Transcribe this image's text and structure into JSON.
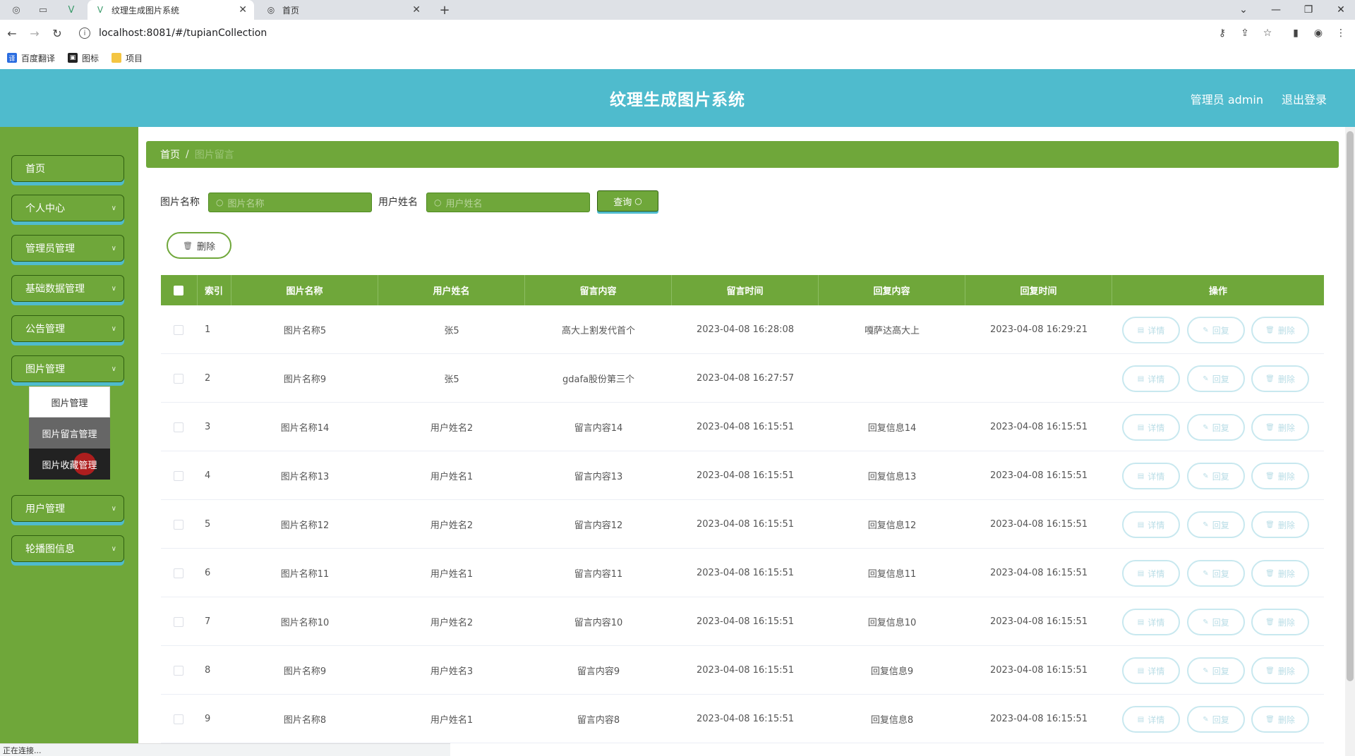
{
  "browser": {
    "tabs": [
      {
        "title": "纹理生成图片系统",
        "active": true
      },
      {
        "title": "首页",
        "active": false
      }
    ],
    "url": "localhost:8081/#/tupianCollection",
    "bookmarks": [
      "百度翻译",
      "图标",
      "项目"
    ],
    "status": "正在连接..."
  },
  "header": {
    "title": "纹理生成图片系统",
    "admin": "管理员 admin",
    "logout": "退出登录",
    "color": "#4fbbcd"
  },
  "sidebar": {
    "color": "#6fa73a",
    "items": [
      {
        "label": "首页",
        "expandable": false
      },
      {
        "label": "个人中心",
        "expandable": true
      },
      {
        "label": "管理员管理",
        "expandable": true
      },
      {
        "label": "基础数据管理",
        "expandable": true
      },
      {
        "label": "公告管理",
        "expandable": true
      },
      {
        "label": "图片管理",
        "expandable": true
      },
      {
        "label": "用户管理",
        "expandable": true
      },
      {
        "label": "轮播图信息",
        "expandable": true
      }
    ],
    "submenu": [
      "图片管理",
      "图片留言管理",
      "图片收藏管理"
    ]
  },
  "breadcrumb": {
    "home": "首页",
    "separator": "/",
    "current": "图片留言"
  },
  "filters": {
    "name_label": "图片名称",
    "name_placeholder": "图片名称",
    "user_label": "用户姓名",
    "user_placeholder": "用户姓名",
    "search_label": "查询"
  },
  "toolbar": {
    "delete_label": "删除"
  },
  "table": {
    "headers": [
      "索引",
      "图片名称",
      "用户姓名",
      "留言内容",
      "留言时间",
      "回复内容",
      "回复时间",
      "操作"
    ],
    "actions": [
      "详情",
      "回复",
      "删除"
    ],
    "rows": [
      [
        "1",
        "图片名称5",
        "张5",
        "高大上割发代首个",
        "2023-04-08 16:28:08",
        "嘎萨达高大上",
        "2023-04-08 16:29:21"
      ],
      [
        "2",
        "图片名称9",
        "张5",
        "gdafa股份第三个",
        "2023-04-08 16:27:57",
        "",
        ""
      ],
      [
        "3",
        "图片名称14",
        "用户姓名2",
        "留言内容14",
        "2023-04-08 16:15:51",
        "回复信息14",
        "2023-04-08 16:15:51"
      ],
      [
        "4",
        "图片名称13",
        "用户姓名1",
        "留言内容13",
        "2023-04-08 16:15:51",
        "回复信息13",
        "2023-04-08 16:15:51"
      ],
      [
        "5",
        "图片名称12",
        "用户姓名2",
        "留言内容12",
        "2023-04-08 16:15:51",
        "回复信息12",
        "2023-04-08 16:15:51"
      ],
      [
        "6",
        "图片名称11",
        "用户姓名1",
        "留言内容11",
        "2023-04-08 16:15:51",
        "回复信息11",
        "2023-04-08 16:15:51"
      ],
      [
        "7",
        "图片名称10",
        "用户姓名2",
        "留言内容10",
        "2023-04-08 16:15:51",
        "回复信息10",
        "2023-04-08 16:15:51"
      ],
      [
        "8",
        "图片名称9",
        "用户姓名3",
        "留言内容9",
        "2023-04-08 16:15:51",
        "回复信息9",
        "2023-04-08 16:15:51"
      ],
      [
        "9",
        "图片名称8",
        "用户姓名1",
        "留言内容8",
        "2023-04-08 16:15:51",
        "回复信息8",
        "2023-04-08 16:15:51"
      ]
    ]
  }
}
